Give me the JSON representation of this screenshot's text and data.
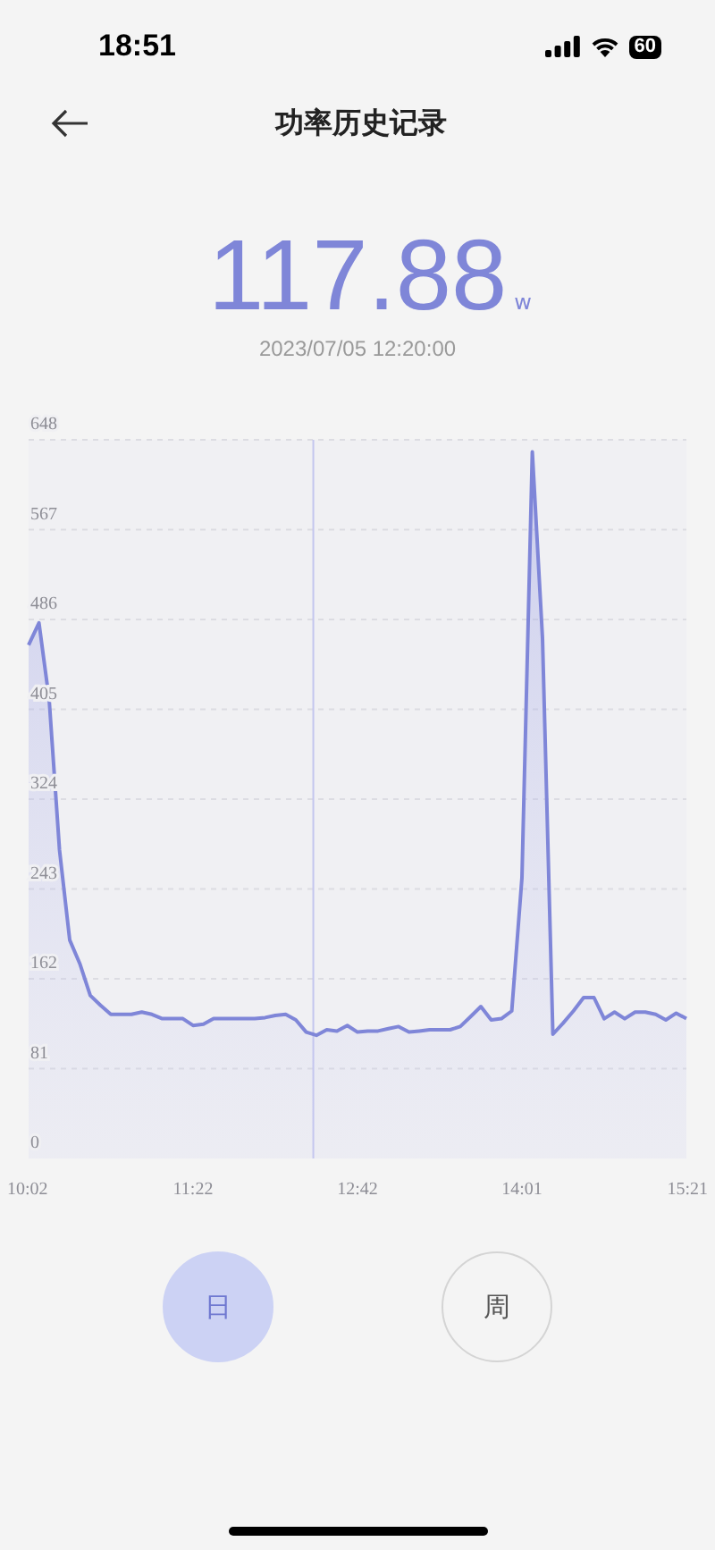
{
  "status_bar": {
    "time": "18:51",
    "battery": "60"
  },
  "header": {
    "title": "功率历史记录"
  },
  "reading": {
    "value": "117.88",
    "unit": "w",
    "timestamp": "2023/07/05 12:20:00"
  },
  "chart": {
    "chart_data": {
      "type": "area",
      "categories": [
        "10:02",
        null,
        null,
        null,
        null,
        null,
        null,
        null,
        null,
        null,
        null,
        null,
        null,
        null,
        null,
        null,
        "11:22",
        null,
        null,
        null,
        null,
        null,
        null,
        null,
        null,
        null,
        null,
        null,
        null,
        null,
        null,
        null,
        "12:42",
        null,
        null,
        null,
        null,
        null,
        null,
        null,
        null,
        null,
        null,
        null,
        null,
        null,
        null,
        null,
        "14:01",
        null,
        null,
        null,
        null,
        null,
        null,
        null,
        null,
        null,
        null,
        null,
        null,
        null,
        null,
        null,
        "15:21"
      ],
      "series": [
        {
          "color": "#7f86d8",
          "values": [
            463,
            483,
            414,
            278,
            197,
            175,
            147,
            138,
            130,
            130,
            130,
            132,
            130,
            126,
            126,
            126,
            120,
            121,
            126,
            126,
            126,
            126,
            126,
            127,
            129,
            130,
            125,
            114,
            111,
            116,
            115,
            120,
            114,
            115,
            115,
            117,
            119,
            114,
            115,
            116,
            116,
            116,
            119,
            128,
            137,
            125,
            126,
            133,
            253,
            637,
            469,
            112,
            122,
            133,
            145,
            145,
            126,
            132,
            126,
            132,
            132,
            130,
            125,
            131,
            126
          ]
        }
      ],
      "ylim": [
        0,
        648
      ],
      "yticks": [
        0,
        81,
        162,
        243,
        324,
        405,
        486,
        567,
        648
      ],
      "grid": true
    }
  },
  "periods": [
    {
      "label": "日",
      "selected": true
    },
    {
      "label": "周",
      "selected": false
    }
  ]
}
